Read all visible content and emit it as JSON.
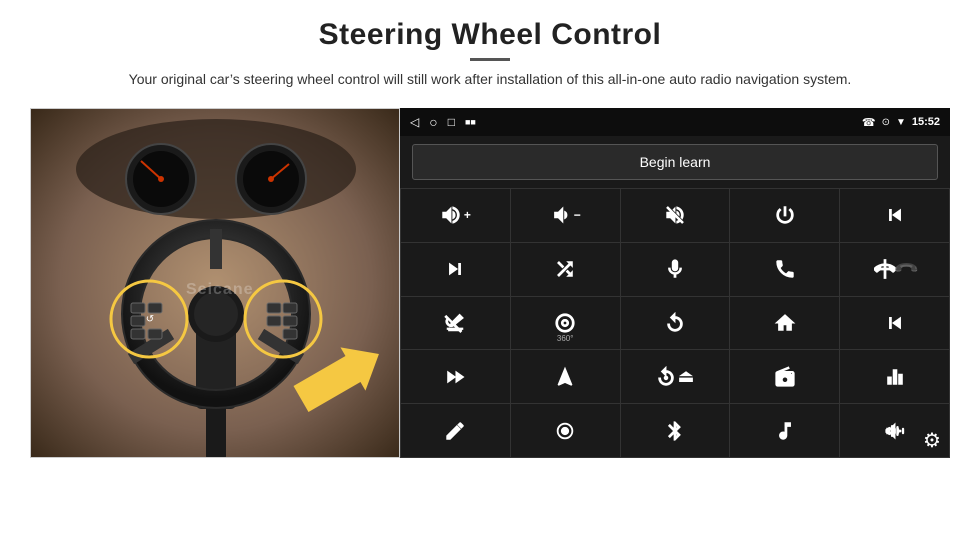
{
  "page": {
    "title": "Steering Wheel Control",
    "subtitle": "Your original car’s steering wheel control will still work after installation of this all-in-one auto radio navigation system.",
    "divider": "—"
  },
  "status_bar": {
    "phone_icon": "☎",
    "location_icon": "⊙",
    "wifi_icon": "▼",
    "time": "15:52",
    "nav_back": "◁",
    "nav_home": "○",
    "nav_square": "□",
    "signal": "■■"
  },
  "begin_learn": {
    "label": "Begin learn"
  },
  "controls": [
    {
      "icon": "vol_up",
      "symbol": "🔊+"
    },
    {
      "icon": "vol_down",
      "symbol": "🔉−"
    },
    {
      "icon": "mute",
      "symbol": "🔇"
    },
    {
      "icon": "power",
      "symbol": "⏻"
    },
    {
      "icon": "prev_track",
      "symbol": "⏮"
    },
    {
      "icon": "next_track",
      "symbol": "⏭"
    },
    {
      "icon": "shuffle",
      "symbol": "⇌⏭"
    },
    {
      "icon": "mic",
      "symbol": "🎤"
    },
    {
      "icon": "phone",
      "symbol": "📞"
    },
    {
      "icon": "hang_up",
      "symbol": "📵"
    },
    {
      "icon": "horn_off",
      "symbol": "🔕"
    },
    {
      "icon": "360_view",
      "symbol": "⊙"
    },
    {
      "icon": "undo",
      "symbol": "↩"
    },
    {
      "icon": "home",
      "symbol": "⌂"
    },
    {
      "icon": "skip_start",
      "symbol": "⏮⏮"
    },
    {
      "icon": "fast_forward",
      "symbol": "⏩"
    },
    {
      "icon": "navigate",
      "symbol": "➤"
    },
    {
      "icon": "eject",
      "symbol": "⏏"
    },
    {
      "icon": "radio",
      "symbol": "📻"
    },
    {
      "icon": "equalizer",
      "symbol": "🎛"
    },
    {
      "icon": "edit",
      "symbol": "✎"
    },
    {
      "icon": "record",
      "symbol": "⏺"
    },
    {
      "icon": "bluetooth",
      "symbol": "⚡"
    },
    {
      "icon": "music",
      "symbol": "♫"
    },
    {
      "icon": "waveform",
      "symbol": "|||"
    }
  ],
  "gear_icon": "⚙",
  "watermark": "Seicane",
  "colors": {
    "background": "#ffffff",
    "panel_bg": "#1a1a1a",
    "button_bg": "#1a1a1a",
    "border": "#333333",
    "text_primary": "#222222",
    "accent": "#f5c842"
  }
}
